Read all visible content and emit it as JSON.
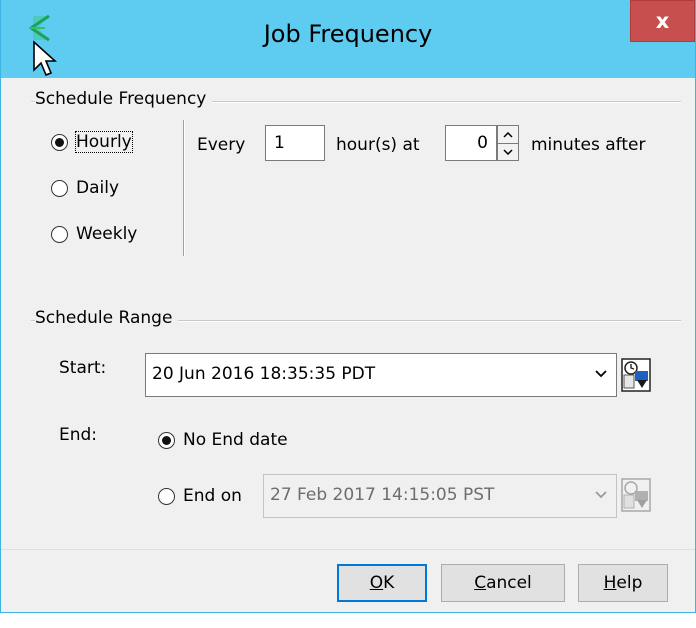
{
  "window": {
    "title": "Job Frequency",
    "close_label": "x"
  },
  "schedule_frequency": {
    "legend": "Schedule Frequency",
    "options": [
      {
        "label": "Hourly",
        "selected": true
      },
      {
        "label": "Daily",
        "selected": false
      },
      {
        "label": "Weekly",
        "selected": false
      }
    ],
    "every_label": "Every",
    "every_value": "1",
    "hours_at_label": "hour(s) at",
    "minutes_value": "0",
    "minutes_after_label": "minutes after"
  },
  "schedule_range": {
    "legend": "Schedule Range",
    "start_label": "Start:",
    "start_value": "20 Jun 2016 18:35:35 PDT",
    "end_label": "End:",
    "no_end_label": "No End date",
    "end_on_label": "End on",
    "end_on_value": "27 Feb 2017 14:15:05 PST",
    "end_mode": "no_end"
  },
  "buttons": {
    "ok": {
      "mnemonic": "O",
      "rest": "K"
    },
    "cancel": {
      "mnemonic": "C",
      "rest": "ancel"
    },
    "help": {
      "mnemonic": "H",
      "rest": "elp"
    }
  },
  "colors": {
    "titlebar": "#5ecbf1",
    "close": "#c7504f",
    "dialog_bg": "#f0f0f0"
  }
}
